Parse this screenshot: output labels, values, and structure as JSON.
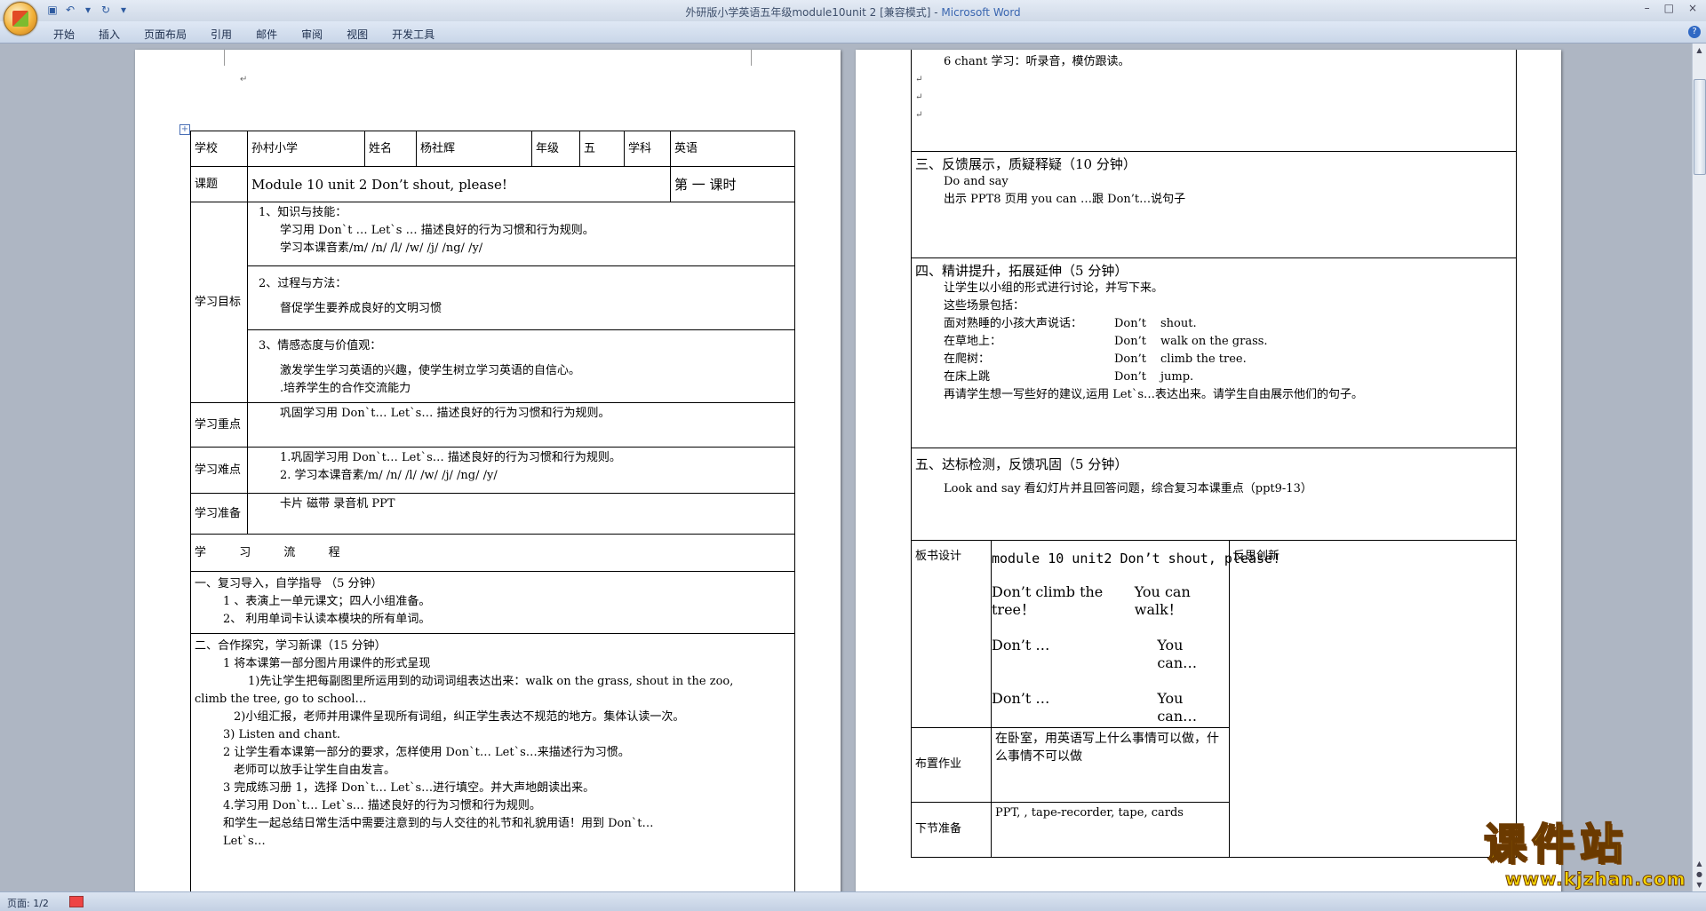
{
  "window": {
    "title": "外研版小学英语五年级module10unit 2 [兼容模式] - ",
    "app_name": "Microsoft Word",
    "minimize": "–",
    "maximize": "□",
    "close": "×"
  },
  "ribbon": {
    "tabs": [
      "开始",
      "插入",
      "页面布局",
      "引用",
      "邮件",
      "审阅",
      "视图",
      "开发工具"
    ],
    "help": "?"
  },
  "page1": {
    "header_row": {
      "school_label": "学校",
      "school_value": "孙村小学",
      "name_label": "姓名",
      "name_value": "杨社辉",
      "grade_label": "年级",
      "grade_value": "五",
      "subject_label": "学科",
      "subject_value": "英语"
    },
    "topic_row": {
      "label": "课题",
      "value": "Module 10 unit 2 Don’t shout, please!",
      "period": "第   一  课时"
    },
    "goals": {
      "label": "学习目标",
      "knowledge_title": "1、知识与技能：",
      "knowledge_lines": [
        "学习用  Don`t …  Let`s …  描述良好的行为习惯和行为规则。",
        "学习本课音素/m/ /n/ /l/ /w/ /j/ /ng/ /y/"
      ],
      "process_title": "2、过程与方法：",
      "process_lines": [
        "督促学生要养成良好的文明习惯"
      ],
      "attitude_title": "3、情感态度与价值观：",
      "attitude_lines": [
        "激发学生学习英语的兴趣，使学生树立学习英语的自信心。",
        ".培养学生的合作交流能力"
      ]
    },
    "key_points": {
      "label": "学习重点",
      "text": "巩固学习用  Don`t…  Let`s…    描述良好的行为习惯和行为规则。"
    },
    "difficulties": {
      "label": "学习难点",
      "lines": [
        "1.巩固学习用  Don`t…  Let`s…    描述良好的行为习惯和行为规则。",
        "2. 学习本课音素/m/ /n/ /l/ /w/ /j/ /ng/ /y/"
      ]
    },
    "preparation": {
      "label": "学习准备",
      "text": "卡片  磁带  录音机  PPT"
    },
    "process_header": "学         习         流         程",
    "section1": {
      "title": "一、复习导入，自学指导   （5 分钟）",
      "lines": [
        "1 、表演上一单元课文；四人小组准备。",
        "2、  利用单词卡认读本模块的所有单词。"
      ]
    },
    "section2": {
      "title": "二、合作探究，学习新课（15 分钟）",
      "lines": [
        "1 将本课第一部分图片用课件的形式呈现",
        "1)先让学生把每副图里所运用到的动词词组表达出来：walk on the grass, shout in the zoo,",
        "climb the tree, go to school…",
        "2)小组汇报，老师并用课件呈现所有词组，纠正学生表达不规范的地方。集体认读一次。",
        "3) Listen and chant.",
        "2 让学生看本课第一部分的要求，怎样使用 Don`t…  Let`s…来描述行为习惯。",
        "老师可以放手让学生自由发言。",
        "3 完成练习册 1，选择 Don`t…  Let`s…进行填空。并大声地朗读出来。",
        "4.学习用 Don`t…  Let`s…  描述良好的行为习惯和行为规则。",
        "和学生一起总结日常生活中需要注意到的与人交往的礼节和礼貌用语！用到 Don`t…",
        "Let`s…"
      ]
    }
  },
  "page2": {
    "cont_lines": [
      "6 chant 学习：听录音，模仿跟读。"
    ],
    "section3": {
      "title": "三、反馈展示，质疑释疑（10 分钟）",
      "lines": [
        "Do and say",
        "出示 PPT8 页用  you can …跟  Don’t…说句子"
      ]
    },
    "section4": {
      "title": "四、精讲提升，拓展延伸（5 分钟）",
      "lines": [
        "让学生以小组的形式进行讨论，并写下来。",
        "这些场景包括：",
        "再请学生想一写些好的建议,运用 Let`s…表达出来。请学生自由展示他们的句子。"
      ],
      "scenes": [
        {
          "place": "面对熟睡的小孩大声说话：",
          "dont": "Don’t",
          "action": "shout."
        },
        {
          "place": "在草地上：",
          "dont": "Don’t",
          "action": "walk on the grass."
        },
        {
          "place": "在爬树：",
          "dont": "Don’t",
          "action": "climb the tree."
        },
        {
          "place": "在床上跳",
          "dont": "Don’t",
          "action": "jump."
        }
      ]
    },
    "section5": {
      "title": "五、达标检测，反馈巩固（5 分钟）",
      "lines": [
        "Look and say  看幻灯片并且回答问题，综合复习本课重点（ppt9-13）"
      ]
    },
    "board": {
      "label": "板书设计",
      "heading": "module 10 unit2  Don’t shout, please!",
      "rows": [
        {
          "left": "Don’t   climb the tree！",
          "right": "You can walk！"
        },
        {
          "left": "Don’t   …",
          "right": "You can…"
        },
        {
          "left": "Don’t   …",
          "right": "You can…"
        }
      ],
      "reflection_label": "反思创新"
    },
    "homework": {
      "label": "布置作业",
      "text": "在卧室，用英语写上什么事情可以做，什么事情不可以做"
    },
    "next": {
      "label": "下节准备",
      "text": "PPT, , tape-recorder, tape, cards"
    }
  },
  "status_bar": {
    "page": "页面: 1/2"
  },
  "watermark": {
    "cn": "课件站",
    "url": "www.kjzhan.com"
  },
  "colors": {
    "workspace": "#aeb6c3",
    "ribbon": "#dfe8f5",
    "title_app": "#3a66b0",
    "watermark_yellow": "#f5d400"
  }
}
